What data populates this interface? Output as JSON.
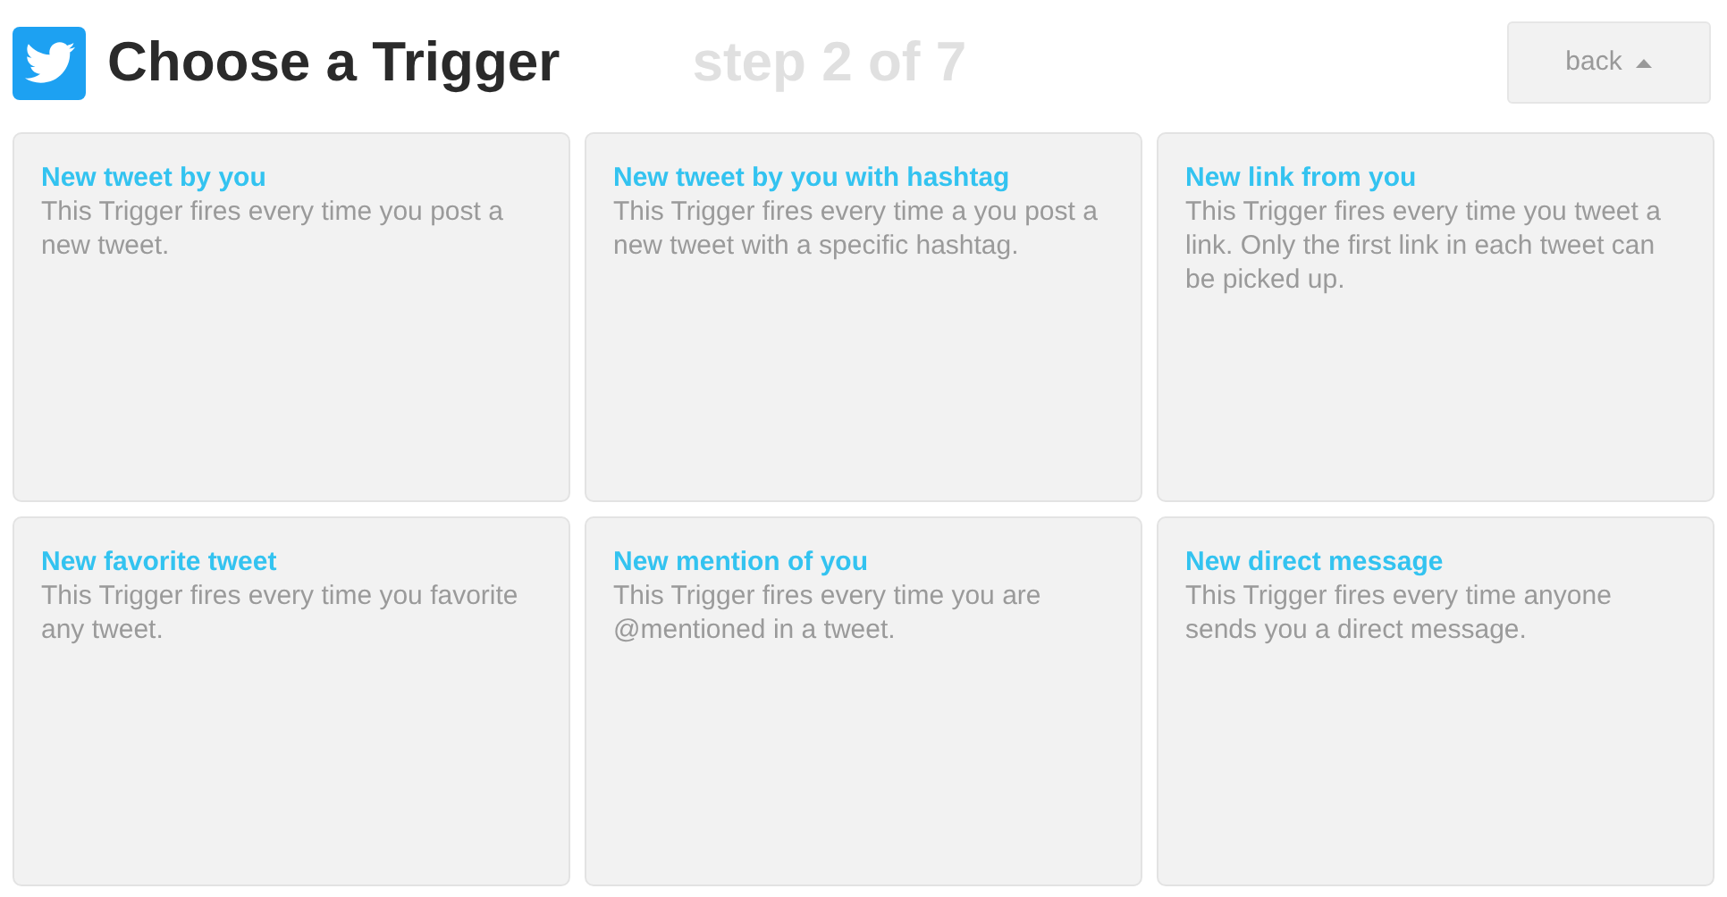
{
  "header": {
    "title": "Choose a Trigger",
    "step": "step 2 of 7",
    "back_button": "back"
  },
  "triggers": [
    {
      "title": "New tweet by you",
      "description": "This Trigger fires every time you post a new tweet."
    },
    {
      "title": "New tweet by you with hashtag",
      "description": "This Trigger fires every time a you post a new tweet with a specific hashtag."
    },
    {
      "title": "New link from you",
      "description": "This Trigger fires every time you tweet a link. Only the first link in each tweet can be picked up."
    },
    {
      "title": "New favorite tweet",
      "description": "This Trigger fires every time you favorite any tweet."
    },
    {
      "title": "New mention of you",
      "description": "This Trigger fires every time you are @mentioned in a tweet."
    },
    {
      "title": "New direct message",
      "description": "This Trigger fires every time anyone sends you a direct message."
    }
  ]
}
